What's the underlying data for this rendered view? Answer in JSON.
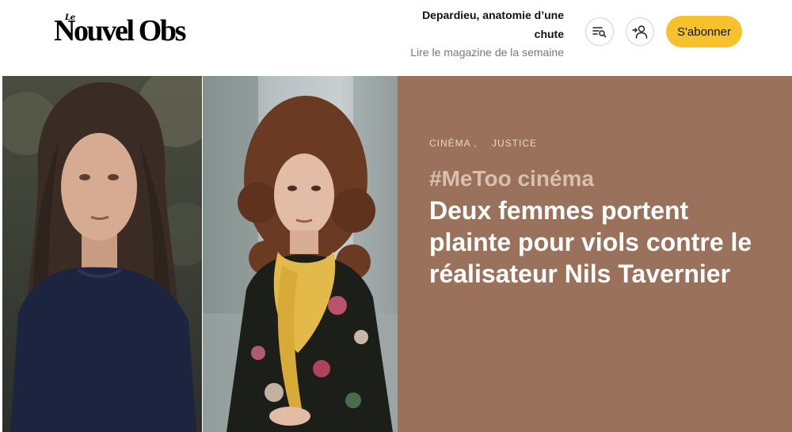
{
  "brand": {
    "le": "Le",
    "name": "Nouvel Obs"
  },
  "magazine": {
    "title": "Depardieu, anatomie d’une chute",
    "subtitle": "Lire le magazine de la semaine"
  },
  "header_buttons": {
    "menu_icon": "menu-search-icon",
    "account_icon": "user-add-icon",
    "subscribe_label": "S'abonner"
  },
  "article": {
    "categories": [
      "CINÉMA ,",
      "JUSTICE"
    ],
    "kicker": "#MeToo cinéma",
    "headline": "Deux femmes portent plainte pour viols contre le réalisateur Nils Tavernier"
  },
  "colors": {
    "accent": "#f5c22d",
    "panel": "#9a715a",
    "kicker": "#d8bfae"
  }
}
